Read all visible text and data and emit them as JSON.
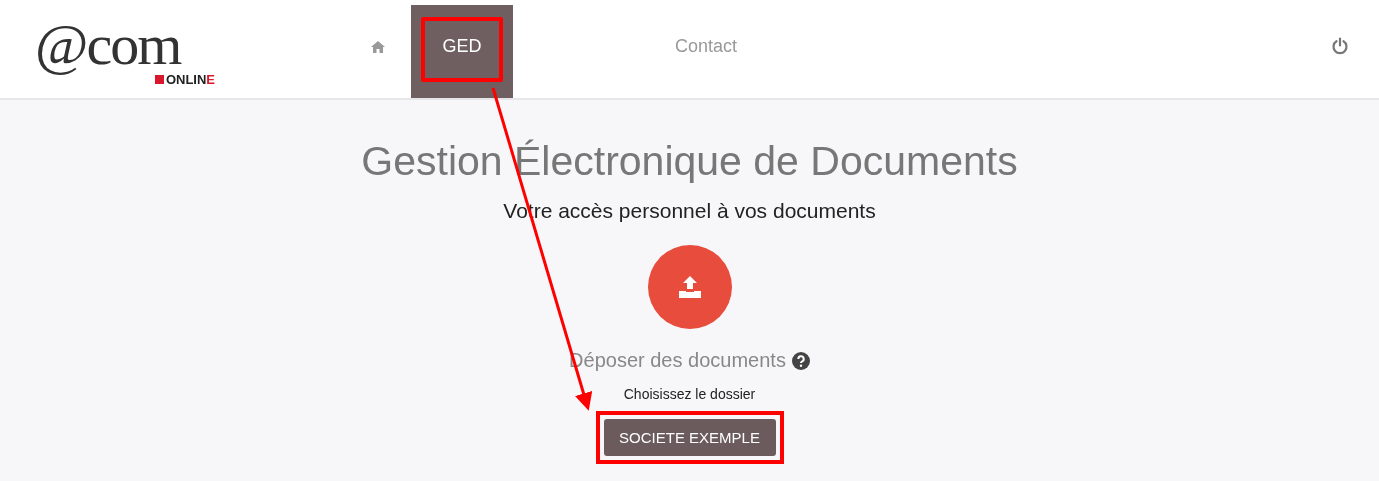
{
  "logo": {
    "mark": "@com",
    "tagline": "ONLIN",
    "tagline_end": "E"
  },
  "nav": [
    {
      "kind": "home",
      "selected": false,
      "highlighted": false
    },
    {
      "kind": "text",
      "label": "GED",
      "selected": true,
      "highlighted": true
    },
    {
      "kind": "text",
      "label": "Contact",
      "selected": false,
      "highlighted": false
    }
  ],
  "main": {
    "title": "Gestion Électronique de Documents",
    "subtitle": "Votre accès personnel à vos documents",
    "upload_label": "Déposer des documents",
    "folder_prompt": "Choisissez le dossier",
    "folders": [
      {
        "label": "SOCIETE EXEMPLE",
        "highlighted": true
      }
    ]
  }
}
